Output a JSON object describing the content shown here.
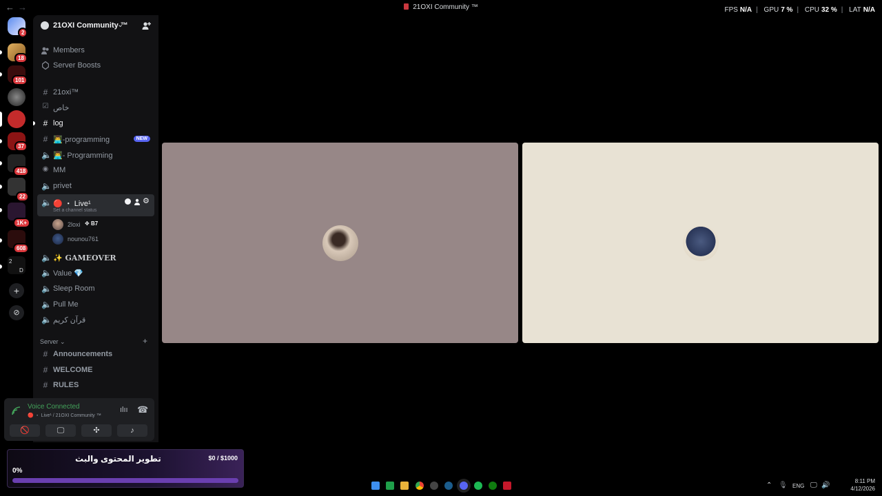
{
  "titlebar": {
    "back": "←",
    "forward": "→",
    "title": "21OXI Community ™"
  },
  "overlay": {
    "fps_label": "FPS",
    "fps_value": "N/A",
    "gpu_label": "GPU",
    "gpu_value": "7 %",
    "cpu_label": "CPU",
    "cpu_value": "32 %",
    "lat_label": "LAT",
    "lat_value": "N/A"
  },
  "rail": {
    "badges": [
      "2",
      "18",
      "101",
      "37",
      "418",
      "22",
      "1K+",
      "608"
    ],
    "folder_labels": [
      "2",
      "D"
    ],
    "add_icon": "+",
    "discover_icon": "⊘"
  },
  "server": {
    "name": "21OXI Community ™",
    "chevron": "⌄",
    "invite_icon": "person-add-icon"
  },
  "channels": {
    "members": "Members",
    "boosts": "Server Boosts",
    "items": [
      {
        "label": "21oxi™"
      },
      {
        "label": "خاص"
      },
      {
        "label": "log"
      },
      {
        "label": "👨‍💻-programming",
        "badge": "NEW"
      },
      {
        "label": "👨‍💻- Programming"
      },
      {
        "label": "MM"
      },
      {
        "label": "privet"
      },
      {
        "label": "🔴 ・ Live¹",
        "status": "Set a channel status"
      },
      {
        "label": "✨ GAMEOVER"
      },
      {
        "label": "Value 💎"
      },
      {
        "label": "Sleep Room"
      },
      {
        "label": "Pull Me"
      },
      {
        "label": "قرآن كريم"
      }
    ],
    "voice_users": [
      {
        "name": "2loxi",
        "tag": "B7"
      },
      {
        "name": "nounou761"
      }
    ],
    "category": "Server",
    "category_chevron": "⌄",
    "category_add": "+",
    "server_channels": [
      "Announcements",
      "WELCOME",
      "RULES"
    ]
  },
  "voice_panel": {
    "status": "Voice Connected",
    "channel": "🔴 ・ Live¹ / 21OXI Community ™"
  },
  "goal": {
    "title": "تطوير المحتوى والبث",
    "amount": "$0 / $1000",
    "percent": "0%",
    "progress": 0
  },
  "stage": {
    "tile_colors": [
      "#978787",
      "#e8e2d4"
    ]
  },
  "taskbar": {
    "lang": "ENG",
    "time": "8:11 PM",
    "date": "4/12/2026"
  }
}
